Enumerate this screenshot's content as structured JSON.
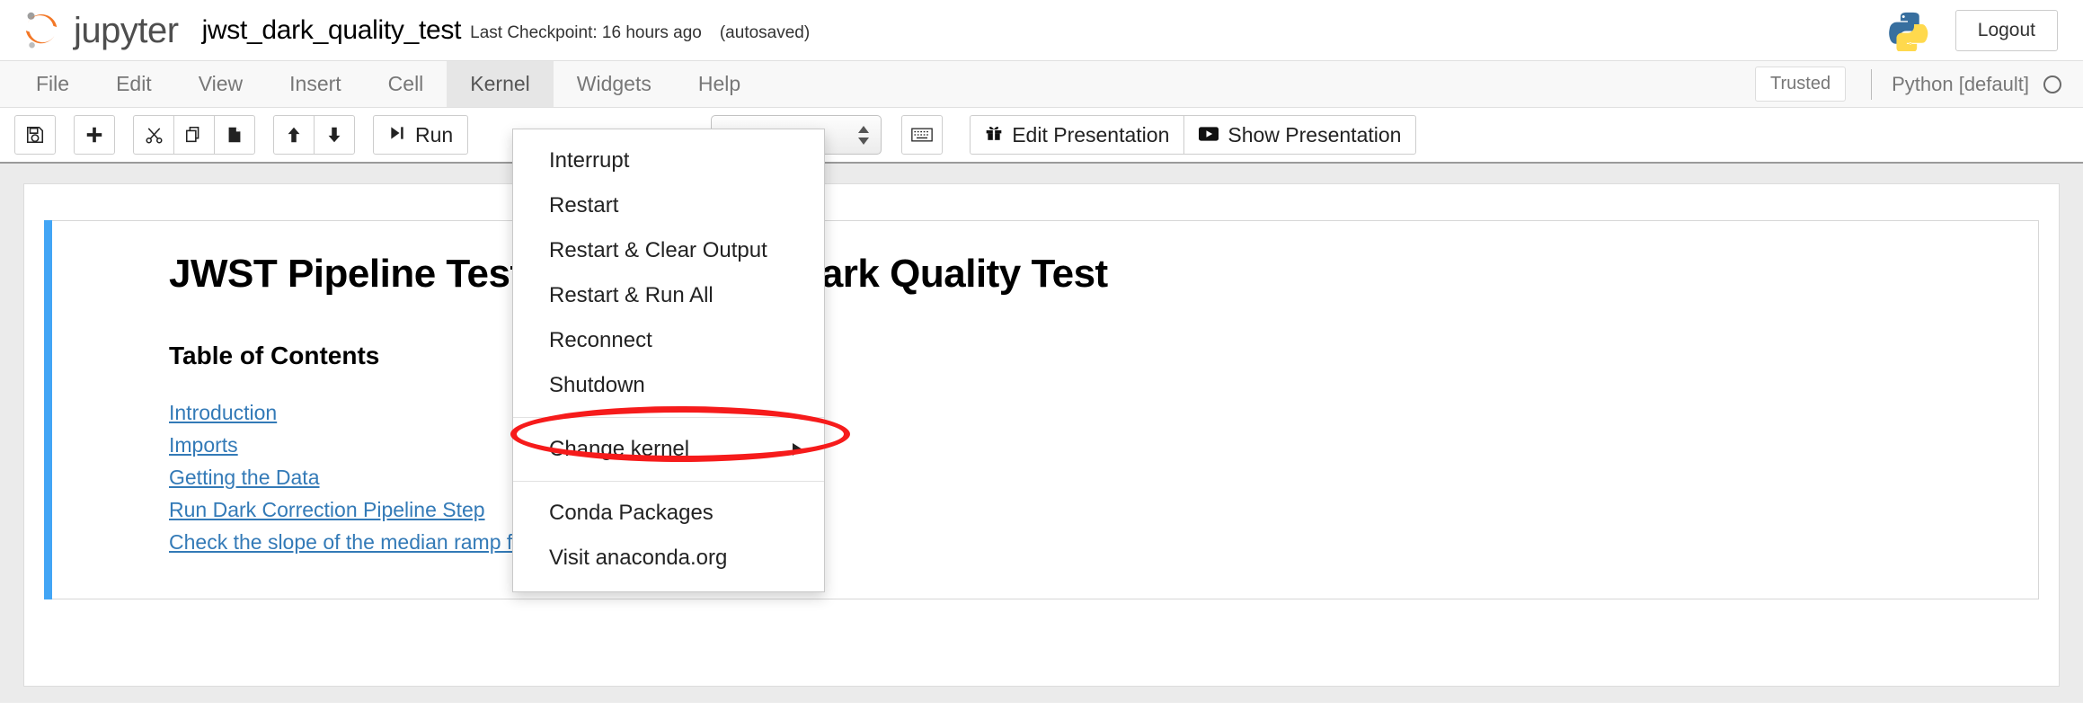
{
  "header": {
    "brand": "jupyter",
    "notebook_name": "jwst_dark_quality_test",
    "checkpoint": "Last Checkpoint: 16 hours ago",
    "autosaved": "(autosaved)",
    "logout_label": "Logout",
    "python_logo_icon": "python-logo-icon",
    "jupyter_logo_icon": "jupyter-logo-icon"
  },
  "menubar": {
    "items": [
      {
        "label": "File",
        "active": false
      },
      {
        "label": "Edit",
        "active": false
      },
      {
        "label": "View",
        "active": false
      },
      {
        "label": "Insert",
        "active": false
      },
      {
        "label": "Cell",
        "active": false
      },
      {
        "label": "Kernel",
        "active": true
      },
      {
        "label": "Widgets",
        "active": false
      },
      {
        "label": "Help",
        "active": false
      }
    ],
    "trusted_label": "Trusted",
    "kernel_name": "Python [default]",
    "kernel_status_icon": "kernel-idle-circle-icon"
  },
  "toolbar": {
    "save_icon": "save-floppy-icon",
    "insert_icon": "add-plus-icon",
    "cut_icon": "cut-scissors-icon",
    "copy_icon": "copy-icon",
    "paste_icon": "paste-icon",
    "move_up_icon": "arrow-up-icon",
    "move_down_icon": "arrow-down-icon",
    "run_label": "Run",
    "run_icon": "run-step-forward-icon",
    "celltype_value": "",
    "keyboard_icon": "keyboard-icon",
    "edit_presentation_label": "Edit Presentation",
    "edit_presentation_icon": "gift-icon",
    "show_presentation_label": "Show Presentation",
    "show_presentation_icon": "play-video-icon"
  },
  "kernel_menu": {
    "items": [
      {
        "label": "Interrupt",
        "submenu": false
      },
      {
        "label": "Restart",
        "submenu": false
      },
      {
        "label": "Restart & Clear Output",
        "submenu": false
      },
      {
        "label": "Restart & Run All",
        "submenu": false
      },
      {
        "label": "Reconnect",
        "submenu": false
      },
      {
        "label": "Shutdown",
        "submenu": false
      }
    ],
    "highlighted": {
      "label": "Change kernel",
      "submenu": true
    },
    "footer_items": [
      {
        "label": "Conda Packages",
        "submenu": false
      },
      {
        "label": "Visit anaconda.org",
        "submenu": false
      }
    ],
    "annotation_color": "#f61b1b"
  },
  "notebook": {
    "title": "JWST Pipeline Testing Notebook: Dark Quality Test",
    "toc_heading": "Table of Contents",
    "toc_links": [
      "Introduction",
      "Imports",
      "Getting the Data",
      "Run Dark Correction Pipeline Step",
      "Check the slope of the median ramp for the detector"
    ],
    "selected_cell_color": "#42a5f5"
  }
}
